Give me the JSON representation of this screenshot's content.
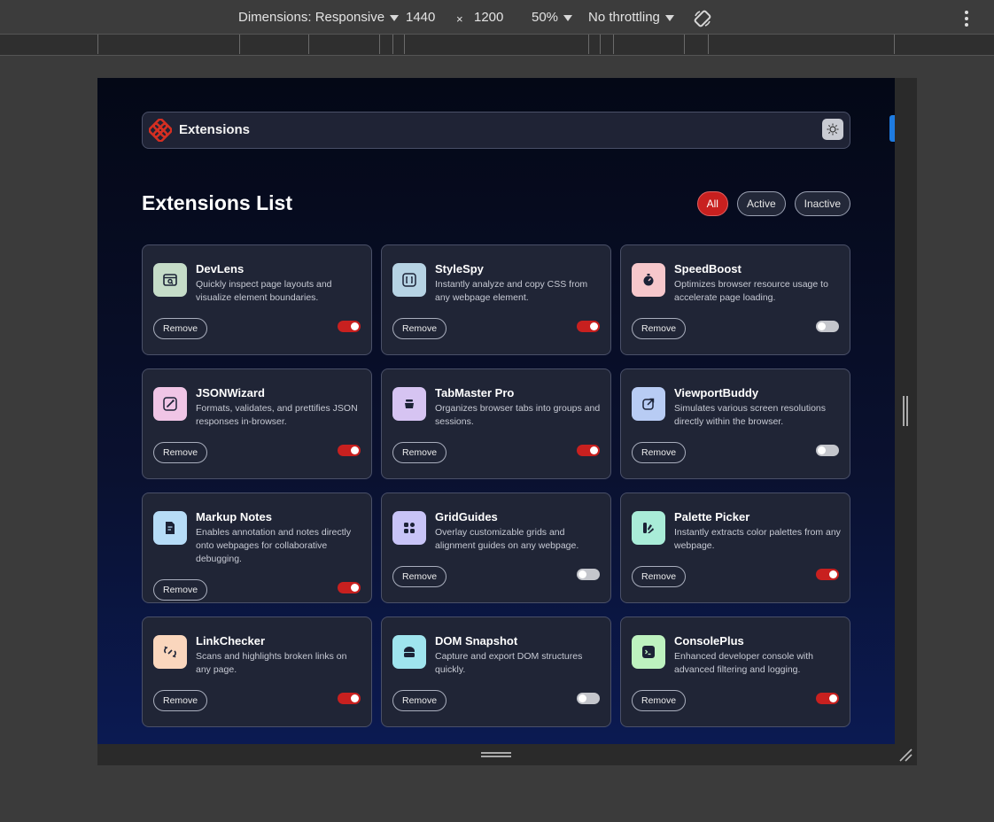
{
  "devtools": {
    "dimensions_label": "Dimensions: Responsive",
    "width": "1440",
    "times": "×",
    "height": "1200",
    "zoom": "50%",
    "throttling": "No throttling"
  },
  "header": {
    "brand": "Extensions"
  },
  "list": {
    "title": "Extensions List",
    "filters": [
      "All",
      "Active",
      "Inactive"
    ],
    "active_filter": "All"
  },
  "remove_label": "Remove",
  "extensions": [
    {
      "name": "DevLens",
      "desc": "Quickly inspect page layouts and visualize element boundaries.",
      "active": true,
      "icon": "magnify-window-icon",
      "icon_bg": "#c5dcc8"
    },
    {
      "name": "StyleSpy",
      "desc": "Instantly analyze and copy CSS from any webpage element.",
      "active": true,
      "icon": "code-brackets-icon",
      "icon_bg": "#b6d3e4"
    },
    {
      "name": "SpeedBoost",
      "desc": "Optimizes browser resource usage to accelerate page loading.",
      "active": false,
      "icon": "stopwatch-icon",
      "icon_bg": "#f6c7cb"
    },
    {
      "name": "JSONWizard",
      "desc": "Formats, validates, and prettifies JSON responses in-browser.",
      "active": true,
      "icon": "wand-icon",
      "icon_bg": "#f0c5e6"
    },
    {
      "name": "TabMaster Pro",
      "desc": "Organizes browser tabs into groups and sessions.",
      "active": true,
      "icon": "tab-stack-icon",
      "icon_bg": "#d6c4f2"
    },
    {
      "name": "ViewportBuddy",
      "desc": "Simulates various screen resolutions directly within the browser.",
      "active": false,
      "icon": "external-window-icon",
      "icon_bg": "#b8ccf4"
    },
    {
      "name": "Markup Notes",
      "desc": "Enables annotation and notes directly onto webpages for collaborative debugging.",
      "active": true,
      "icon": "note-icon",
      "icon_bg": "#b6dcf7"
    },
    {
      "name": "GridGuides",
      "desc": "Overlay customizable grids and alignment guides on any webpage.",
      "active": false,
      "icon": "grid-icon",
      "icon_bg": "#c8c4f7"
    },
    {
      "name": "Palette Picker",
      "desc": "Instantly extracts color palettes from any webpage.",
      "active": true,
      "icon": "palette-icon",
      "icon_bg": "#a9ecd8"
    },
    {
      "name": "LinkChecker",
      "desc": "Scans and highlights broken links on any page.",
      "active": true,
      "icon": "broken-link-icon",
      "icon_bg": "#fad6bd"
    },
    {
      "name": "DOM Snapshot",
      "desc": "Capture and export DOM structures quickly.",
      "active": false,
      "icon": "snapshot-icon",
      "icon_bg": "#9fe4ee"
    },
    {
      "name": "ConsolePlus",
      "desc": "Enhanced developer console with advanced filtering and logging.",
      "active": true,
      "icon": "terminal-icon",
      "icon_bg": "#bdf2bf"
    }
  ]
}
